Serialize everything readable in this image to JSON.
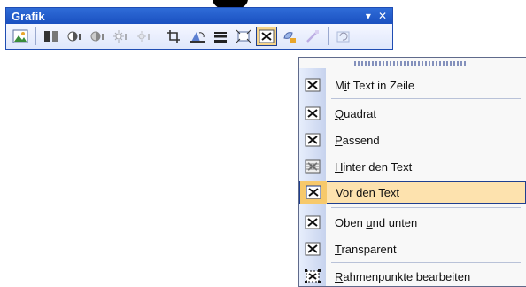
{
  "window": {
    "title": "Grafik"
  },
  "title_buttons": {
    "dropdown": "▾",
    "close": "✕"
  },
  "tools": [
    {
      "name": "insert-picture-icon"
    },
    {
      "name": "color-icon"
    },
    {
      "name": "more-contrast-icon"
    },
    {
      "name": "less-contrast-icon"
    },
    {
      "name": "more-brightness-icon"
    },
    {
      "name": "less-brightness-icon"
    },
    {
      "name": "crop-icon"
    },
    {
      "name": "rotate-left-icon"
    },
    {
      "name": "line-style-icon"
    },
    {
      "name": "compress-icon"
    },
    {
      "name": "text-wrapping-icon"
    },
    {
      "name": "format-picture-icon"
    },
    {
      "name": "set-transparent-color-icon"
    },
    {
      "name": "reset-picture-icon"
    }
  ],
  "menu": {
    "items": [
      {
        "label_pre": "M",
        "label_u": "i",
        "label_post": "t Text in Zeile"
      },
      {
        "label_pre": "",
        "label_u": "Q",
        "label_post": "uadrat"
      },
      {
        "label_pre": "",
        "label_u": "P",
        "label_post": "assend"
      },
      {
        "label_pre": "",
        "label_u": "H",
        "label_post": "inter den Text"
      },
      {
        "label_pre": "",
        "label_u": "V",
        "label_post": "or den Text"
      },
      {
        "label_pre": "Oben ",
        "label_u": "u",
        "label_post": "nd unten"
      },
      {
        "label_pre": "",
        "label_u": "T",
        "label_post": "ransparent"
      },
      {
        "label_pre": "",
        "label_u": "R",
        "label_post": "ahmenpunkte bearbeiten"
      }
    ]
  },
  "colors": {
    "titlebar": "#1a50c0",
    "highlight": "#fde2ae",
    "highlight_border": "#1f3f8f"
  }
}
